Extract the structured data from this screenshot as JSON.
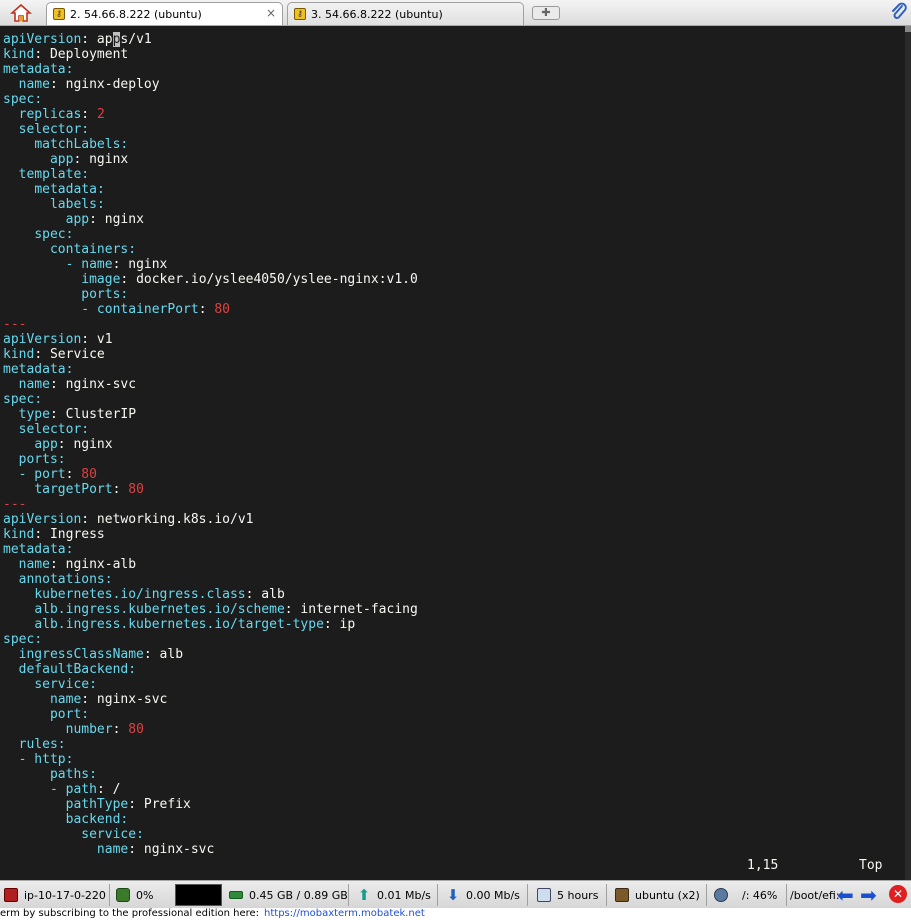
{
  "tabs": [
    {
      "label": "2. 54.66.8.222 (ubuntu)",
      "active": true
    },
    {
      "label": "3. 54.66.8.222 (ubuntu)",
      "active": false
    }
  ],
  "tab_close_glyph": "×",
  "terminal": {
    "lines": [
      [
        [
          "k",
          "apiVersion"
        ],
        [
          "s",
          ": ap"
        ],
        [
          "cur",
          "p"
        ],
        [
          "s",
          "s/v1"
        ]
      ],
      [
        [
          "k",
          "kind"
        ],
        [
          "s",
          ": Deployment"
        ]
      ],
      [
        [
          "k",
          "metadata"
        ],
        [
          "k",
          ":"
        ]
      ],
      [
        [
          "s",
          "  "
        ],
        [
          "k",
          "name"
        ],
        [
          "s",
          ": nginx-deploy"
        ]
      ],
      [
        [
          "k",
          "spec"
        ],
        [
          "k",
          ":"
        ]
      ],
      [
        [
          "s",
          "  "
        ],
        [
          "k",
          "replicas"
        ],
        [
          "s",
          ": "
        ],
        [
          "n",
          "2"
        ]
      ],
      [
        [
          "s",
          "  "
        ],
        [
          "k",
          "selector"
        ],
        [
          "k",
          ":"
        ]
      ],
      [
        [
          "s",
          "    "
        ],
        [
          "k",
          "matchLabels"
        ],
        [
          "k",
          ":"
        ]
      ],
      [
        [
          "s",
          "      "
        ],
        [
          "k",
          "app"
        ],
        [
          "s",
          ": nginx"
        ]
      ],
      [
        [
          "s",
          "  "
        ],
        [
          "k",
          "template"
        ],
        [
          "k",
          ":"
        ]
      ],
      [
        [
          "s",
          "    "
        ],
        [
          "k",
          "metadata"
        ],
        [
          "k",
          ":"
        ]
      ],
      [
        [
          "s",
          "      "
        ],
        [
          "k",
          "labels"
        ],
        [
          "k",
          ":"
        ]
      ],
      [
        [
          "s",
          "        "
        ],
        [
          "k",
          "app"
        ],
        [
          "s",
          ": nginx"
        ]
      ],
      [
        [
          "s",
          "    "
        ],
        [
          "k",
          "spec"
        ],
        [
          "k",
          ":"
        ]
      ],
      [
        [
          "s",
          "      "
        ],
        [
          "k",
          "containers"
        ],
        [
          "k",
          ":"
        ]
      ],
      [
        [
          "s",
          "        "
        ],
        [
          "k",
          "- name"
        ],
        [
          "s",
          ": nginx"
        ]
      ],
      [
        [
          "s",
          "          "
        ],
        [
          "k",
          "image"
        ],
        [
          "s",
          ": docker.io/yslee4050/yslee-nginx:v1.0"
        ]
      ],
      [
        [
          "s",
          "          "
        ],
        [
          "k",
          "ports"
        ],
        [
          "k",
          ":"
        ]
      ],
      [
        [
          "s",
          "          "
        ],
        [
          "k",
          "- containerPort"
        ],
        [
          "s",
          ": "
        ],
        [
          "n",
          "80"
        ]
      ],
      [
        [
          "d",
          "---"
        ]
      ],
      [
        [
          "k",
          "apiVersion"
        ],
        [
          "s",
          ": v1"
        ]
      ],
      [
        [
          "k",
          "kind"
        ],
        [
          "s",
          ": Service"
        ]
      ],
      [
        [
          "k",
          "metadata"
        ],
        [
          "k",
          ":"
        ]
      ],
      [
        [
          "s",
          "  "
        ],
        [
          "k",
          "name"
        ],
        [
          "s",
          ": nginx-svc"
        ]
      ],
      [
        [
          "k",
          "spec"
        ],
        [
          "k",
          ":"
        ]
      ],
      [
        [
          "s",
          "  "
        ],
        [
          "k",
          "type"
        ],
        [
          "s",
          ": ClusterIP"
        ]
      ],
      [
        [
          "s",
          "  "
        ],
        [
          "k",
          "selector"
        ],
        [
          "k",
          ":"
        ]
      ],
      [
        [
          "s",
          "    "
        ],
        [
          "k",
          "app"
        ],
        [
          "s",
          ": nginx"
        ]
      ],
      [
        [
          "s",
          "  "
        ],
        [
          "k",
          "ports"
        ],
        [
          "k",
          ":"
        ]
      ],
      [
        [
          "s",
          "  "
        ],
        [
          "k",
          "- port"
        ],
        [
          "s",
          ": "
        ],
        [
          "n",
          "80"
        ]
      ],
      [
        [
          "s",
          "    "
        ],
        [
          "k",
          "targetPort"
        ],
        [
          "s",
          ": "
        ],
        [
          "n",
          "80"
        ]
      ],
      [
        [
          "d",
          "---"
        ]
      ],
      [
        [
          "k",
          "apiVersion"
        ],
        [
          "s",
          ": networking.k8s.io/v1"
        ]
      ],
      [
        [
          "k",
          "kind"
        ],
        [
          "s",
          ": Ingress"
        ]
      ],
      [
        [
          "k",
          "metadata"
        ],
        [
          "k",
          ":"
        ]
      ],
      [
        [
          "s",
          "  "
        ],
        [
          "k",
          "name"
        ],
        [
          "s",
          ": nginx-alb"
        ]
      ],
      [
        [
          "s",
          "  "
        ],
        [
          "k",
          "annotations"
        ],
        [
          "k",
          ":"
        ]
      ],
      [
        [
          "s",
          "    "
        ],
        [
          "k",
          "kubernetes.io/ingress.class"
        ],
        [
          "s",
          ": alb"
        ]
      ],
      [
        [
          "s",
          "    "
        ],
        [
          "k",
          "alb.ingress.kubernetes.io/scheme"
        ],
        [
          "s",
          ": internet-facing"
        ]
      ],
      [
        [
          "s",
          "    "
        ],
        [
          "k",
          "alb.ingress.kubernetes.io/target-type"
        ],
        [
          "s",
          ": ip"
        ]
      ],
      [
        [
          "k",
          "spec"
        ],
        [
          "k",
          ":"
        ]
      ],
      [
        [
          "s",
          "  "
        ],
        [
          "k",
          "ingressClassName"
        ],
        [
          "s",
          ": alb"
        ]
      ],
      [
        [
          "s",
          "  "
        ],
        [
          "k",
          "defaultBackend"
        ],
        [
          "k",
          ":"
        ]
      ],
      [
        [
          "s",
          "    "
        ],
        [
          "k",
          "service"
        ],
        [
          "k",
          ":"
        ]
      ],
      [
        [
          "s",
          "      "
        ],
        [
          "k",
          "name"
        ],
        [
          "s",
          ": nginx-svc"
        ]
      ],
      [
        [
          "s",
          "      "
        ],
        [
          "k",
          "port"
        ],
        [
          "k",
          ":"
        ]
      ],
      [
        [
          "s",
          "        "
        ],
        [
          "k",
          "number"
        ],
        [
          "s",
          ": "
        ],
        [
          "n",
          "80"
        ]
      ],
      [
        [
          "s",
          "  "
        ],
        [
          "k",
          "rules"
        ],
        [
          "k",
          ":"
        ]
      ],
      [
        [
          "s",
          "  "
        ],
        [
          "k",
          "- http"
        ],
        [
          "k",
          ":"
        ]
      ],
      [
        [
          "s",
          "      "
        ],
        [
          "k",
          "paths"
        ],
        [
          "k",
          ":"
        ]
      ],
      [
        [
          "s",
          "      "
        ],
        [
          "k",
          "- path"
        ],
        [
          "s",
          ": /"
        ]
      ],
      [
        [
          "s",
          "        "
        ],
        [
          "k",
          "pathType"
        ],
        [
          "s",
          ": Prefix"
        ]
      ],
      [
        [
          "s",
          "        "
        ],
        [
          "k",
          "backend"
        ],
        [
          "k",
          ":"
        ]
      ],
      [
        [
          "s",
          "          "
        ],
        [
          "k",
          "service"
        ],
        [
          "k",
          ":"
        ]
      ],
      [
        [
          "s",
          "            "
        ],
        [
          "k",
          "name"
        ],
        [
          "s",
          ": nginx-svc"
        ]
      ]
    ],
    "cursor_position": "1,15",
    "scroll_position": "Top"
  },
  "statusbar": {
    "hostname": "ip-10-17-0-220",
    "cpu": "0%",
    "memory": "0.45 GB / 0.89 GB",
    "upload": "0.01 Mb/s",
    "download": "0.00 Mb/s",
    "uptime": "5 hours",
    "user": "ubuntu (x2)",
    "disk_root": "/: 46%",
    "disk_boot": "/boot/efi:"
  },
  "footer": {
    "text": "erm by subscribing to the professional edition here:",
    "link": "https://mobaxterm.mobatek.net"
  },
  "colors": {
    "terminal_bg": "#1c1c1c",
    "yaml_key": "#66d9ef",
    "yaml_number": "#e04040",
    "text": "#f8f8f2"
  }
}
